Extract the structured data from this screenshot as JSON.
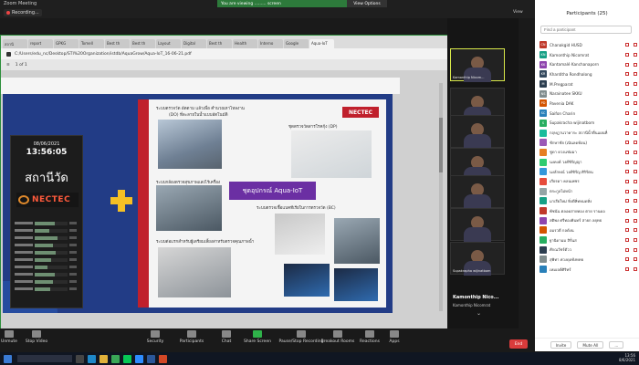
{
  "window": {
    "title": "Zoom Meeting",
    "recording_label": "Recording...",
    "view_label": "View"
  },
  "share_banner": {
    "text": "You are viewing ......... screen",
    "options": "View Options"
  },
  "browser": {
    "tabs": [
      "สถานี",
      "report",
      "GPKG",
      "Tomell",
      "Best th",
      "Best th",
      "Layout",
      "Digital",
      "Best th",
      "Health",
      "Interno",
      "Google",
      "Aqua-IoT"
    ],
    "address": "C:/Users/edu_nc/Desktop/STI%20Organization/istdb/AquaGrow/Aqua-IoT_16-06-21.pdf",
    "pdf_page": "1 of 1"
  },
  "slide": {
    "clock": {
      "date": "08/06/2021",
      "time": "13:56:05",
      "station": "สถานีวัด",
      "logo": "NECTEC"
    },
    "meters": [
      0.6,
      0.45,
      0.7,
      0.55,
      0.65,
      0.5,
      0.4,
      0.6,
      0.55,
      0.48
    ],
    "nectec": "NECTEC",
    "aqua_label": "ชุดอุปกรณ์ Aqua-IoT",
    "cap1": "ระบบตรวจวัด อัตตาม แล้วเพื่อ คำนวณหาไหลงาน",
    "cap1b": "(DO) ที่ละลายในน้ำแบบอัตโนมัติ",
    "cap2": "ชุดตรวจวัดสารโรคกุ้ง (DP)",
    "cap3": "ระบบกล้องตรวจสุขภาพแสงไร้เครื่อง",
    "cap4": "ระบบตรวจเชื้อแบคทีเรียในการตรวจวัด (BC)",
    "cap5": "ระบบต่อแรกสำหรับผู้เตรียมเลี้ยงสาหรับตรวจคุณภาพน้ำ"
  },
  "videos": {
    "names": [
      "Kamonthip Nicom...",
      "",
      "",
      "",
      "",
      "",
      "Supakrapha wijinatbom"
    ],
    "bottom_name": "Kamonthip Nico...",
    "bottom_sub": "Kamonthip Nicomrat"
  },
  "participants": {
    "title": "Participants (25)",
    "search_placeholder": "Find a participant",
    "list": [
      {
        "initials": "CN",
        "name": "Chanakgid HUSD",
        "color": "#c0392b"
      },
      {
        "initials": "KN",
        "name": "Kamonthip Nicomrat",
        "color": "#16a085"
      },
      {
        "initials": "KK",
        "name": "Kantamalé Kanchanaporn",
        "color": "#8e44ad"
      },
      {
        "initials": "KR",
        "name": "Khantitha Rondhalong",
        "color": "#34495e"
      },
      {
        "initials": "M",
        "name": "M.Pregparat",
        "color": "#2c3e50"
      },
      {
        "initials": "NS",
        "name": "Narainatee SKKU",
        "color": "#7f8c8d"
      },
      {
        "initials": "PD",
        "name": "Pavenia DAK",
        "color": "#d35400"
      },
      {
        "initials": "SC",
        "name": "Saifon Charin",
        "color": "#2980b9"
      },
      {
        "initials": "S",
        "name": "Supakracha wijinatbom",
        "color": "#27ae60"
      },
      {
        "initials": "",
        "name": "กฤษฎานวาคาระ สถานีน้ำตื่นแผนที่",
        "color": "#1abc9c"
      },
      {
        "initials": "",
        "name": "ชักษาชัย (เนินลดท้อน)",
        "color": "#9b59b6"
      },
      {
        "initials": "",
        "name": "ชูดา ดวงแช่มมา",
        "color": "#e67e22"
      },
      {
        "initials": "",
        "name": "นงคงค์ วงศ์ชิรัญญา",
        "color": "#2ecc71"
      },
      {
        "initials": "",
        "name": "นงลักษณ์ วงศ์ชิรัญ ศิริรัตน",
        "color": "#3498db"
      },
      {
        "initials": "",
        "name": "เกียรดา คลนเพชร",
        "color": "#e74c3c"
      },
      {
        "initials": "",
        "name": "ตระกูลไม่หน้า",
        "color": "#95a5a6"
      },
      {
        "initials": "",
        "name": "มาเรียใหม่ หิ่งดีหิ่ทหมดหิ่ง",
        "color": "#16a085"
      },
      {
        "initials": "",
        "name": "พัชนัน ตลอดสายทอง ตาย รานดอ",
        "color": "#c0392b"
      },
      {
        "initials": "",
        "name": "สติพง ศรีทองคินทร์ สายก ลยุทธ",
        "color": "#8e44ad"
      },
      {
        "initials": "",
        "name": "อมรวดี กลดังน",
        "color": "#d35400"
      },
      {
        "initials": "",
        "name": "ฐานิดามม สิรั่นส",
        "color": "#27ae60"
      },
      {
        "initials": "",
        "name": "ศักณวัชร์ตัวว",
        "color": "#2c3e50"
      },
      {
        "initials": "",
        "name": "สุพิทา ค่วงดุลทังหทย",
        "color": "#7f8c8d"
      },
      {
        "initials": "",
        "name": "เหมเจต์ศิริทร์",
        "color": "#2980b9"
      }
    ],
    "invite": "Invite",
    "mute_all": "Mute All",
    "more": "..."
  },
  "toolbar": {
    "unmute": "Unmute",
    "stop_video": "Stop Video",
    "security": "Security",
    "participants": "Participants",
    "participants_count": "25",
    "chat": "Chat",
    "share": "Share Screen",
    "record": "Pause/Stop Recording",
    "breakout": "Breakout Rooms",
    "reactions": "Reactions",
    "apps": "Apps",
    "end": "End"
  },
  "tray": {
    "time": "13:56",
    "date": "8/6/2021",
    "lang": "ENG"
  }
}
